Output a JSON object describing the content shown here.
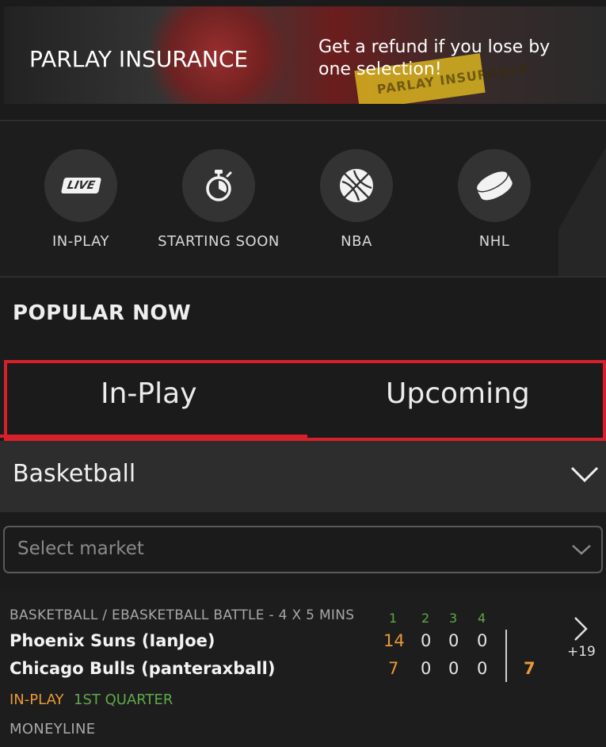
{
  "banner": {
    "title": "PARLAY INSURANCE",
    "subtitle": "Get a refund if you lose by one selection!",
    "sign_text": "PARLAY INSURANCE"
  },
  "quick_nav": [
    {
      "label": "IN-PLAY",
      "icon": "live-icon",
      "badge": "LIVE"
    },
    {
      "label": "STARTING SOON",
      "icon": "stopwatch-icon"
    },
    {
      "label": "NBA",
      "icon": "basketball-icon"
    },
    {
      "label": "NHL",
      "icon": "hockey-puck-icon"
    }
  ],
  "popular": {
    "title": "POPULAR NOW"
  },
  "tabs": [
    {
      "label": "In-Play",
      "active": true
    },
    {
      "label": "Upcoming",
      "active": false
    }
  ],
  "sport_select": {
    "value": "Basketball"
  },
  "market_select": {
    "placeholder": "Select market"
  },
  "event": {
    "league": "BASKETBALL / EBASKETBALL BATTLE - 4 X 5 MINS",
    "quarters": [
      "1",
      "2",
      "3",
      "4"
    ],
    "teams": [
      {
        "name": "Phoenix Suns (IanJoe)",
        "scores": [
          "14",
          "0",
          "0",
          "0"
        ]
      },
      {
        "name": "Chicago Bulls (panteraxball)",
        "scores": [
          "7",
          "0",
          "0",
          "0"
        ]
      }
    ],
    "total": "7",
    "more_markets": "+19",
    "status_live": "IN-PLAY",
    "status_period": "1ST QUARTER",
    "market_label": "MONEYLINE"
  },
  "colors": {
    "accent": "#d7202a",
    "score_orange": "#e89a36",
    "quarter_green": "#5fa84a",
    "background": "#1b1b1b"
  }
}
